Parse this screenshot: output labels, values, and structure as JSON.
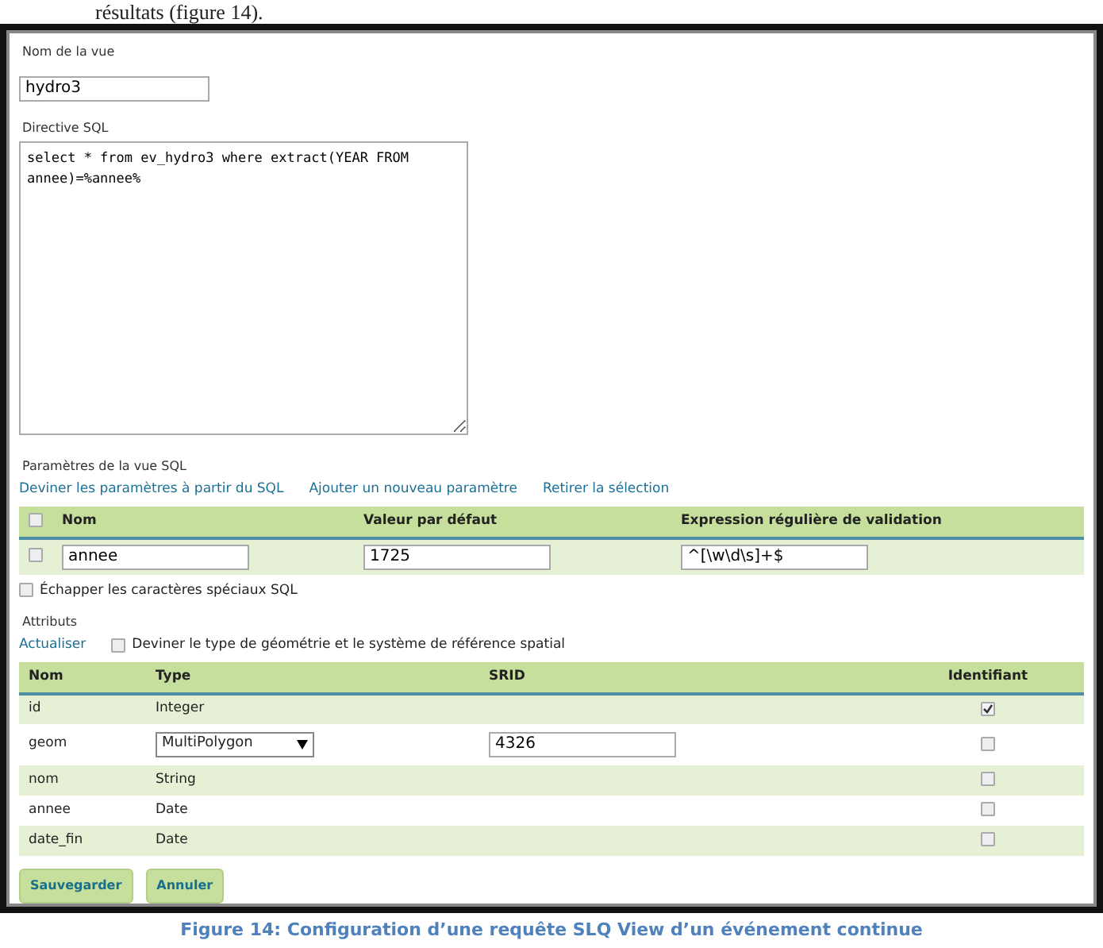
{
  "doc_text_above": "résultats (figure 14).",
  "view_name": {
    "label": "Nom de la vue",
    "value": "hydro3"
  },
  "sql": {
    "label": "Directive SQL",
    "value": "select * from ev_hydro3 where extract(YEAR FROM annee)=%annee%"
  },
  "parameters": {
    "title": "Paramètres de la vue SQL",
    "links": [
      "Deviner les paramètres à partir du SQL",
      "Ajouter un nouveau paramètre",
      "Retirer la sélection"
    ],
    "columns": [
      "Nom",
      "Valeur par défaut",
      "Expression régulière de validation"
    ],
    "header_checked": false,
    "rows": [
      {
        "checked": false,
        "name": "annee",
        "default": "1725",
        "regex": "^[\\w\\d\\s]+$"
      }
    ],
    "escape": {
      "label": "Échapper les caractères spéciaux SQL",
      "checked": false
    }
  },
  "attributes": {
    "title": "Attributs",
    "refresh": "Actualiser",
    "guess": {
      "label": "Deviner le type de géométrie et le système de référence spatial",
      "checked": false
    },
    "columns": [
      "Nom",
      "Type",
      "SRID",
      "Identifiant"
    ],
    "rows": [
      {
        "kind": "text",
        "name": "id",
        "type": "Integer",
        "identifier": true
      },
      {
        "kind": "geometry",
        "name": "geom",
        "type": "MultiPolygon",
        "srid": "4326",
        "identifier": false
      },
      {
        "kind": "text",
        "name": "nom",
        "type": "String",
        "identifier": false
      },
      {
        "kind": "text",
        "name": "annee",
        "type": "Date",
        "identifier": false
      },
      {
        "kind": "text",
        "name": "date_fin",
        "type": "Date",
        "identifier": false
      }
    ]
  },
  "buttons": [
    "Sauvegarder",
    "Annuler"
  ],
  "caption": "Figure 14: Configuration d’une requête  SLQ View  d’un événement continue"
}
